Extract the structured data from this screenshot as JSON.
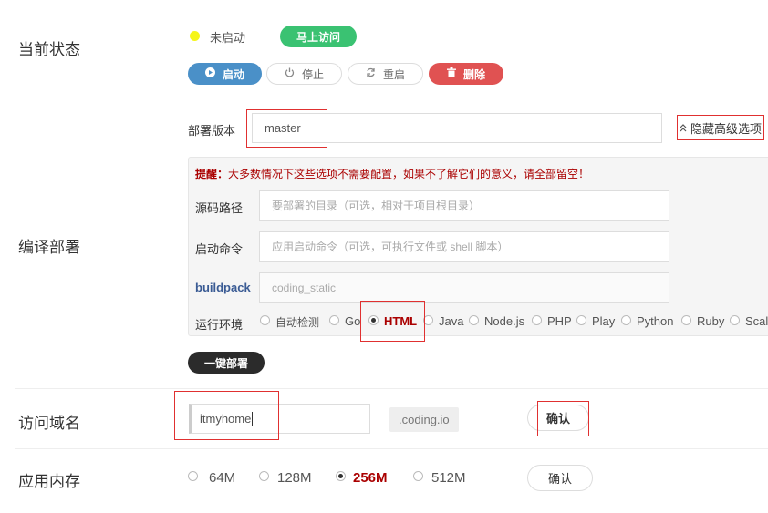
{
  "status": {
    "label": "当前状态",
    "state_text": "未启动",
    "visit_button": "马上访问",
    "actions": {
      "start": "启动",
      "stop": "停止",
      "restart": "重启",
      "delete": "删除"
    }
  },
  "build": {
    "label": "编译部署",
    "version_label": "部署版本",
    "version_value": "master",
    "toggle_advanced": "隐藏高级选项",
    "hint_prefix": "提醒：",
    "hint_text": "大多数情况下这些选项不需要配置，如果不了解它们的意义，请全部留空！",
    "source_label": "源码路径",
    "source_placeholder": "要部署的目录（可选，相对于项目根目录）",
    "command_label": "启动命令",
    "command_placeholder": "应用启动命令（可选，可执行文件或 shell 脚本）",
    "buildpack_label": "buildpack",
    "buildpack_value": "coding_static",
    "env_label": "运行环境",
    "env_options": [
      "自动检测",
      "Go",
      "HTML",
      "Java",
      "Node.js",
      "PHP",
      "Play",
      "Python",
      "Ruby",
      "Scala"
    ],
    "env_selected": "HTML",
    "deploy_button": "一键部署"
  },
  "domain": {
    "label": "访问域名",
    "value": "itmyhome",
    "suffix": ".coding.io",
    "confirm": "确认"
  },
  "memory": {
    "label": "应用内存",
    "options": [
      "64M",
      "128M",
      "256M",
      "512M"
    ],
    "selected": "256M",
    "confirm": "确认"
  },
  "colors": {
    "green": "#3ac272",
    "blue": "#4a90c8",
    "red": "#e05252",
    "highlight_box": "#e03030",
    "selected_text": "#aa0000",
    "status_dot": "#f5f519"
  },
  "icons": [
    "play-icon",
    "power-icon",
    "refresh-icon",
    "trash-icon",
    "chevron-up-icon"
  ]
}
